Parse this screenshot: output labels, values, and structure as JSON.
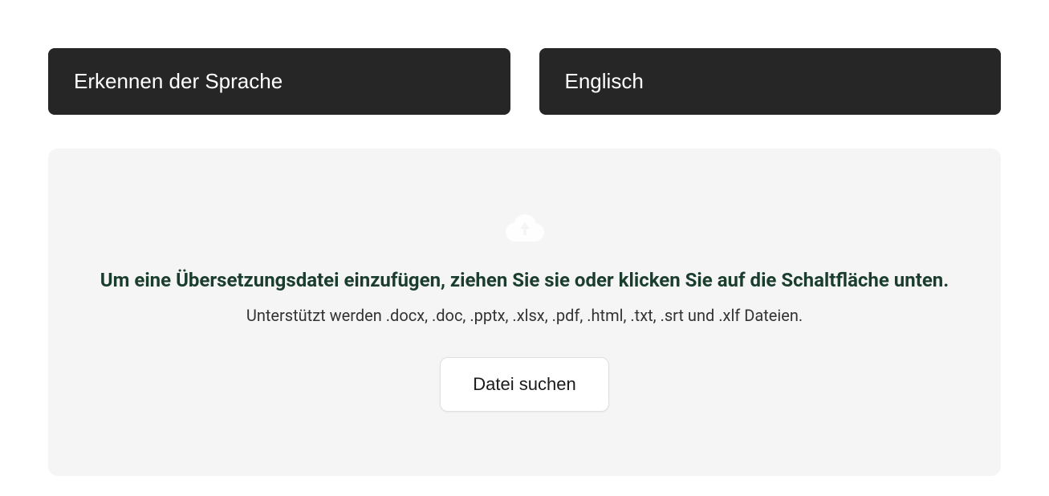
{
  "languageSelectors": {
    "source": "Erkennen der Sprache",
    "target": "Englisch"
  },
  "dropzone": {
    "title": "Um eine Übersetzungsdatei einzufügen, ziehen Sie sie oder klicken Sie auf die Schaltfläche unten.",
    "subtitle": "Unterstützt werden .docx, .doc, .pptx, .xlsx, .pdf, .html, .txt, .srt und .xlf Dateien.",
    "browseButtonLabel": "Datei suchen"
  }
}
